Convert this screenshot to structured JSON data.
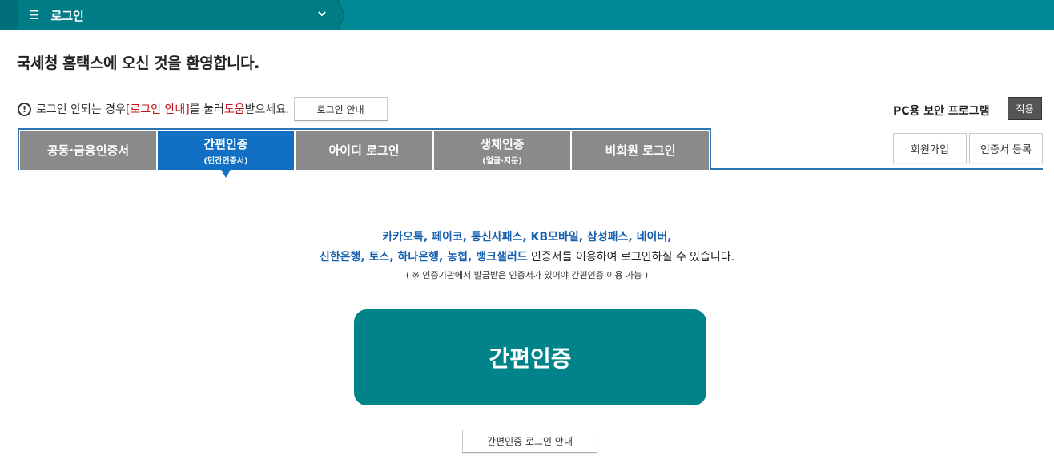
{
  "topbar": {
    "menu_icon": "hamburger-icon",
    "menu_label": "로그인",
    "chevron_icon": "chevron-down-icon"
  },
  "welcome": "국세청 홈택스에 오신 것을 환영합니다.",
  "notice": {
    "icon": "info-circle-icon",
    "text_before": "로그인 안되는 경우 ",
    "link_text": "[로그인 안내]",
    "text_middle": "를 눌러 ",
    "help_text": "도움",
    "text_after": "받으세요.",
    "button_label": "로그인 안내"
  },
  "security": {
    "label": "PC용 보안 프로그램",
    "apply_label": "적용"
  },
  "tabs": [
    {
      "label": "공동·금융인증서",
      "sub": ""
    },
    {
      "label": "간편인증",
      "sub": "(민간인증서)"
    },
    {
      "label": "아이디 로그인",
      "sub": ""
    },
    {
      "label": "생체인증",
      "sub": "(얼굴·지문)"
    },
    {
      "label": "비회원 로그인",
      "sub": ""
    }
  ],
  "side_buttons": {
    "signup": "회원가입",
    "cert_register": "인증서 등록"
  },
  "description": {
    "line1_blue": "카카오톡, 페이코, 통신사패스, KB모바일, 삼성패스, 네이버,",
    "line2_blue": "신한은행, 토스, 하나은행, 농협, 뱅크샐러드",
    "line2_rest": " 인증서를 이용하여 로그인하실 수 있습니다.",
    "note": "( ※ 인증기관에서 발급받은 인증서가 있어야 간편인증 이용 가능 )"
  },
  "main_button": "간편인증",
  "guide_button": "간편인증 로그인 안내",
  "colors": {
    "topbar": "#008894",
    "active_tab": "#1170c4",
    "inactive_tab": "#8a8a8a",
    "main_button": "#008389",
    "link_red": "#c4121b",
    "provider_blue": "#1660b0"
  }
}
